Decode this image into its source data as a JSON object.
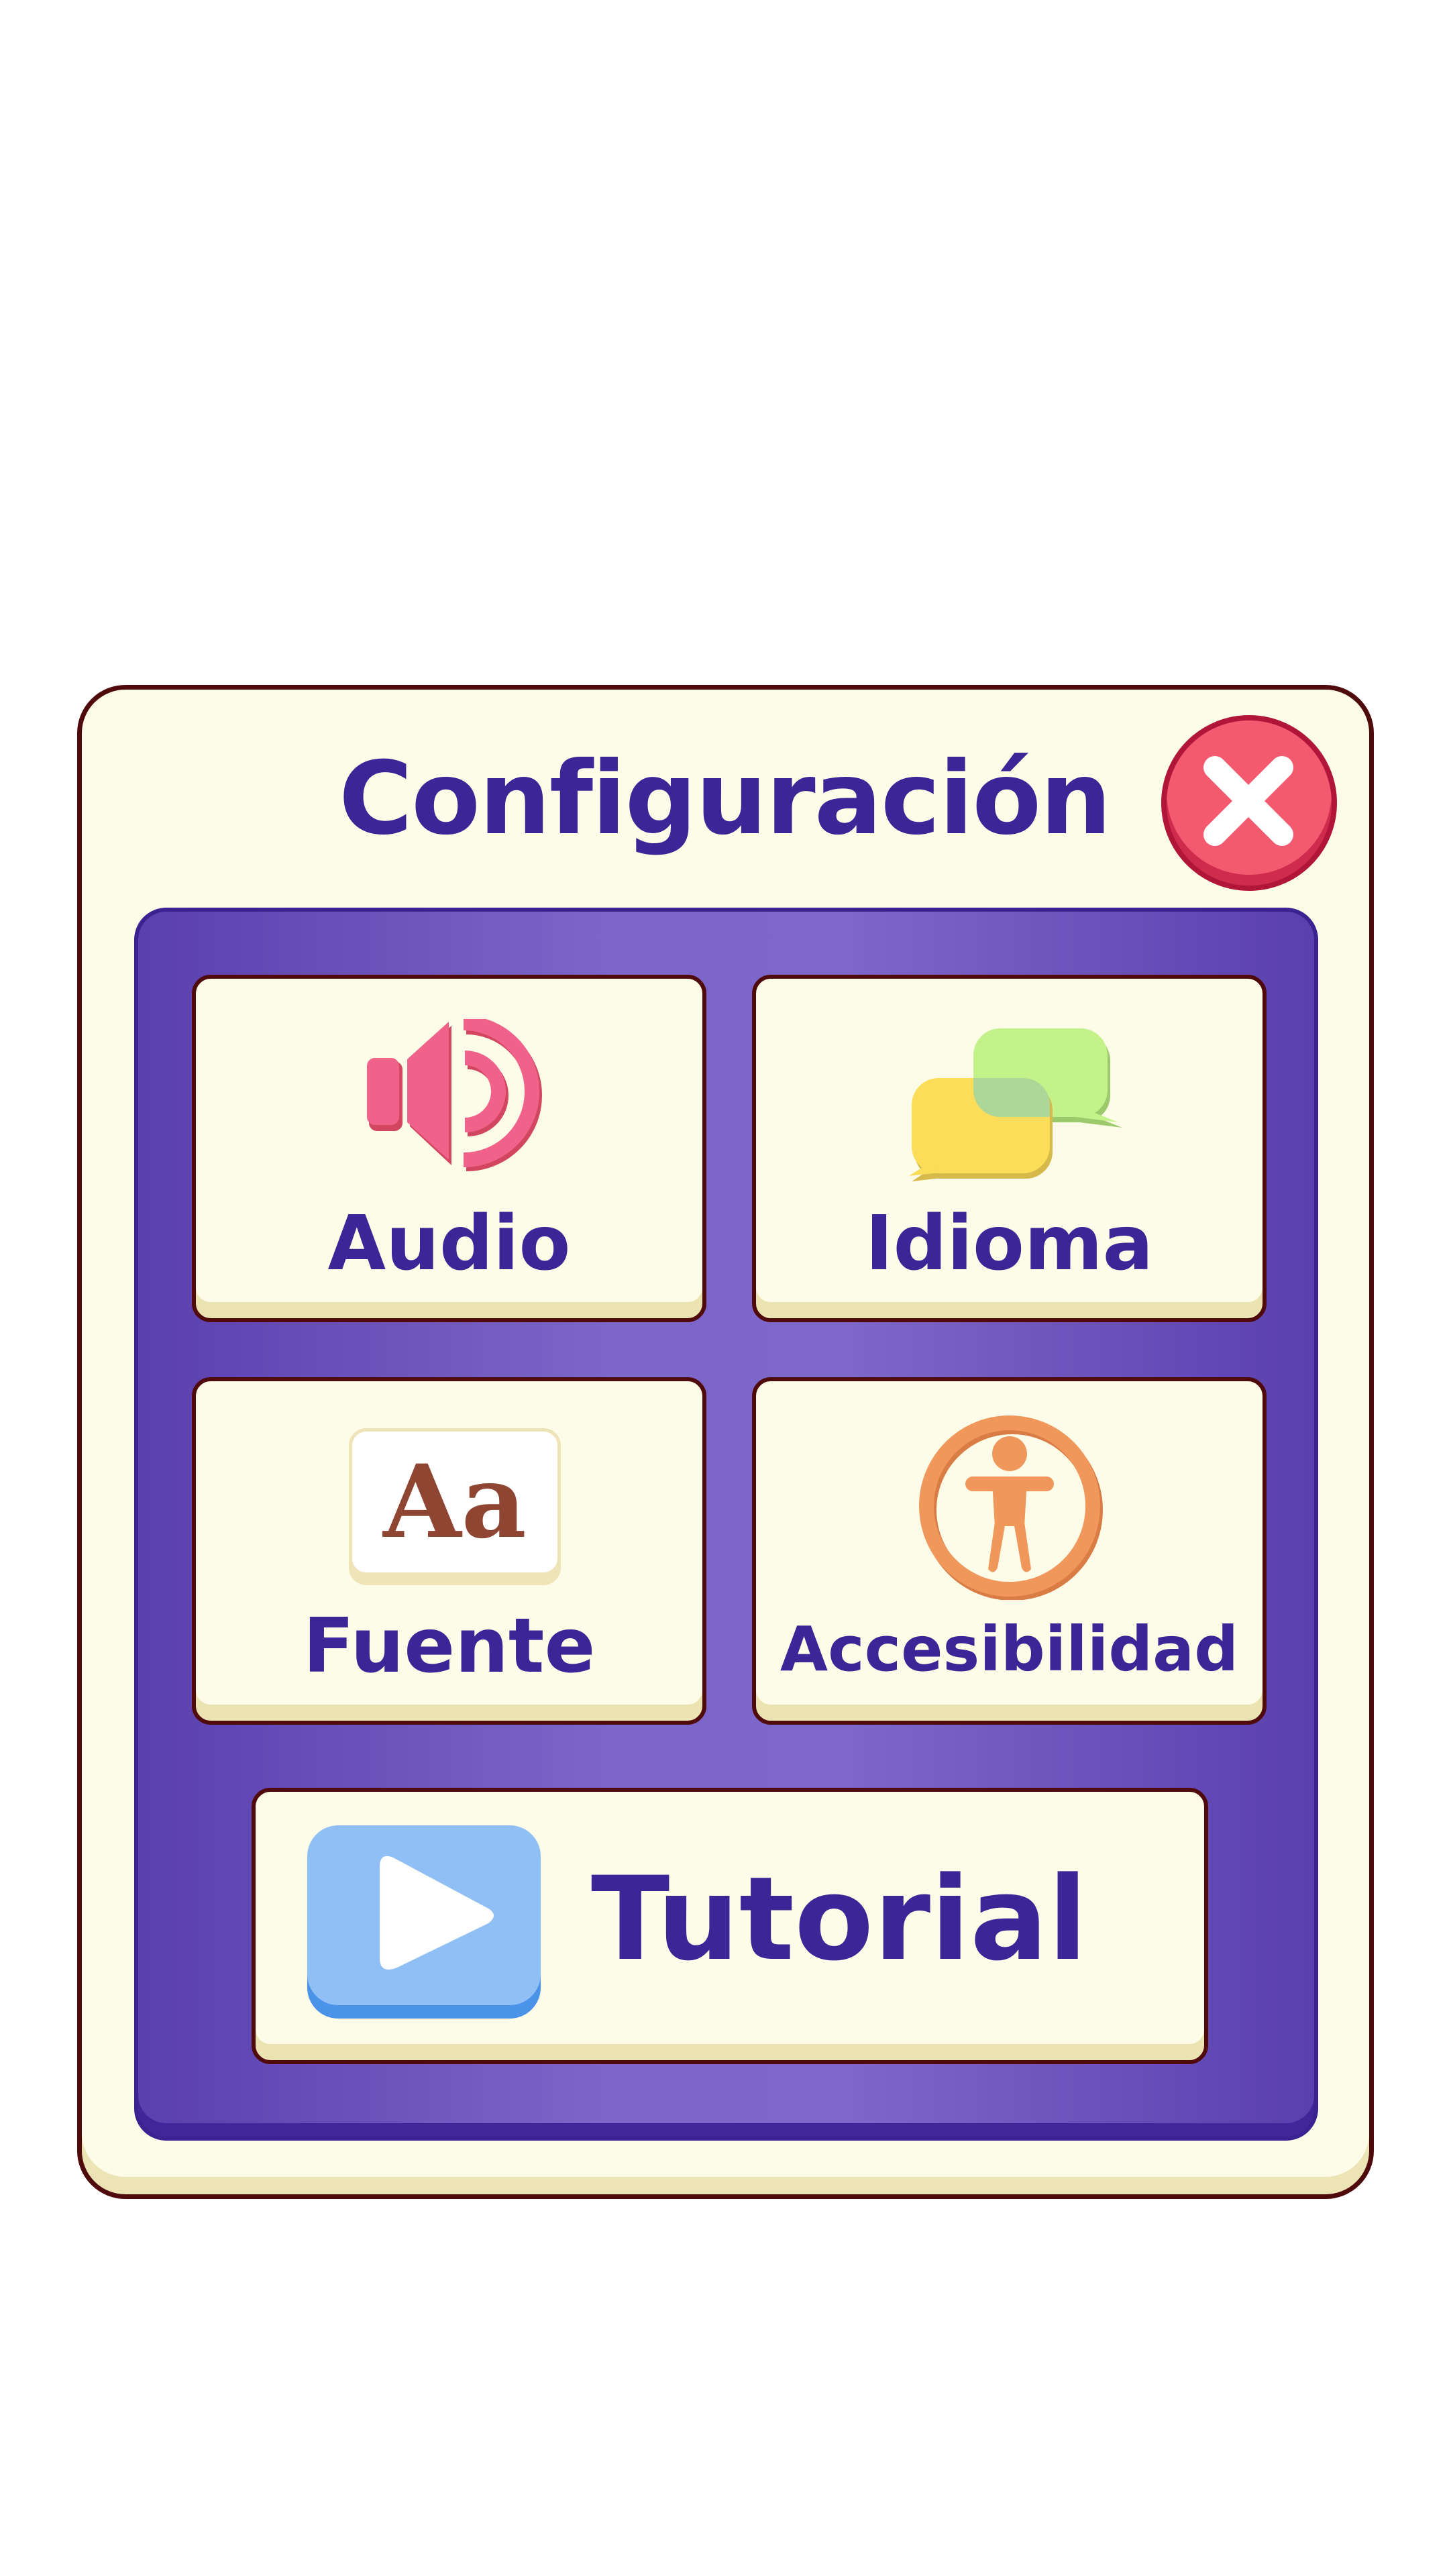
{
  "dialog": {
    "title": "Configuración",
    "close_icon": "close-icon"
  },
  "options": {
    "audio": {
      "label": "Audio",
      "icon": "speaker-icon"
    },
    "language": {
      "label": "Idioma",
      "icon": "speech-bubbles-icon"
    },
    "font": {
      "label": "Fuente",
      "icon": "font-icon",
      "glyph": "Aa"
    },
    "accessibility": {
      "label": "Accesibilidad",
      "icon": "accessibility-person-icon"
    },
    "tutorial": {
      "label": "Tutorial",
      "icon": "play-icon"
    }
  },
  "colors": {
    "panel": "#fdfce8",
    "panel_border": "#4f0a0c",
    "inner_panel": "#6a51bd",
    "text": "#3c2596",
    "close": "#f3596f",
    "speaker": "#f0628a",
    "bubble_yellow": "#fbdd5a",
    "bubble_green": "#c3f28a",
    "font_glyph": "#8e4532",
    "accessibility": "#f0975c",
    "play": "#90bff5"
  }
}
